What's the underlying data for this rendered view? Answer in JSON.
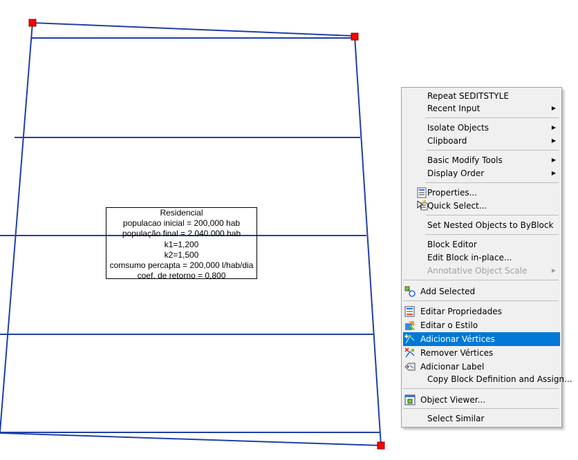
{
  "drawing": {
    "label_lines": [
      "Residencial",
      "populacao inicial = 200,000 hab",
      "população final = 2.040.000 hab",
      "k1=1,200",
      "k2=1,500",
      "comsumo percapta = 200,000 l/hab/dia",
      "coef. de retorno = 0,800"
    ],
    "polyline_color": "#1f3fa8",
    "grip_color": "#ff0000"
  },
  "context_menu": {
    "items": [
      {
        "label": "Repeat SEDITSTYLE"
      },
      {
        "label": "Recent Input",
        "submenu": true
      },
      {
        "label": "Isolate Objects",
        "submenu": true
      },
      {
        "label": "Clipboard",
        "submenu": true
      },
      {
        "label": "Basic Modify Tools",
        "submenu": true
      },
      {
        "label": "Display Order",
        "submenu": true
      },
      {
        "label": "Properties...",
        "icon": "properties-icon"
      },
      {
        "label": "Quick Select...",
        "icon": "quick-select-icon"
      },
      {
        "label": "Set Nested Objects to ByBlock"
      },
      {
        "label": "Block Editor"
      },
      {
        "label": "Edit Block in-place..."
      },
      {
        "label": "Annotative Object Scale",
        "submenu": true,
        "disabled": true
      },
      {
        "label": "Add Selected",
        "icon": "add-selected-icon"
      },
      {
        "label": "Editar Propriedades",
        "icon": "edit-properties-icon"
      },
      {
        "label": "Editar o Estilo",
        "icon": "edit-style-icon"
      },
      {
        "label": "Adicionar Vértices",
        "icon": "add-vertex-icon",
        "selected": true
      },
      {
        "label": "Remover Vértices",
        "icon": "remove-vertex-icon"
      },
      {
        "label": "Adicionar Label",
        "icon": "add-label-icon"
      },
      {
        "label": "Copy Block Definition and Assign..."
      },
      {
        "label": "Object Viewer...",
        "icon": "object-viewer-icon"
      },
      {
        "label": "Select Similar"
      }
    ],
    "highlight_color": "#0078d7"
  }
}
